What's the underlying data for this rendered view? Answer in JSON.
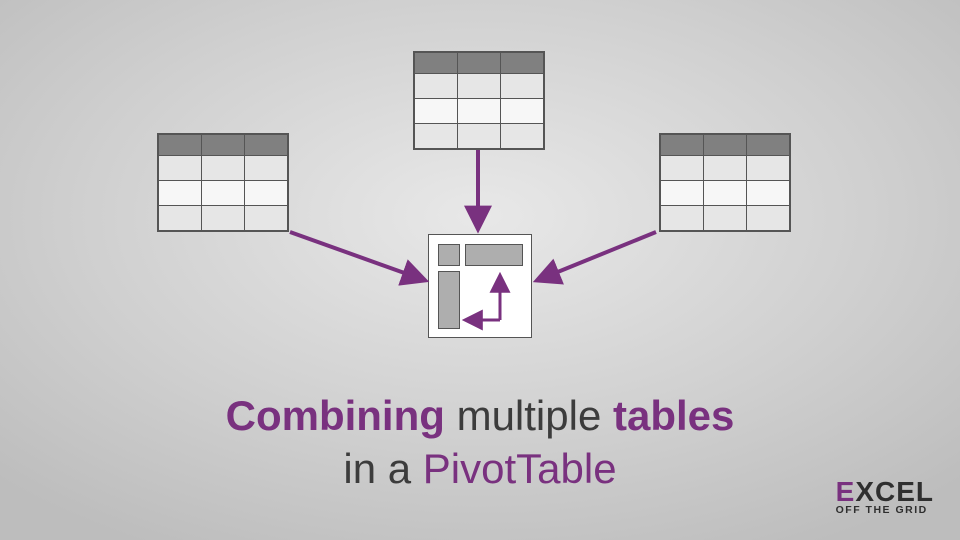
{
  "colors": {
    "accent": "#79317f",
    "text": "#3c3c3c"
  },
  "headline": {
    "w1": "Combining",
    "w2": "multiple",
    "w3": "tables",
    "w4": "in a",
    "w5": "PivotTable"
  },
  "logo": {
    "e": "E",
    "xcel": "XCEL",
    "sub": "OFF THE GRID"
  }
}
